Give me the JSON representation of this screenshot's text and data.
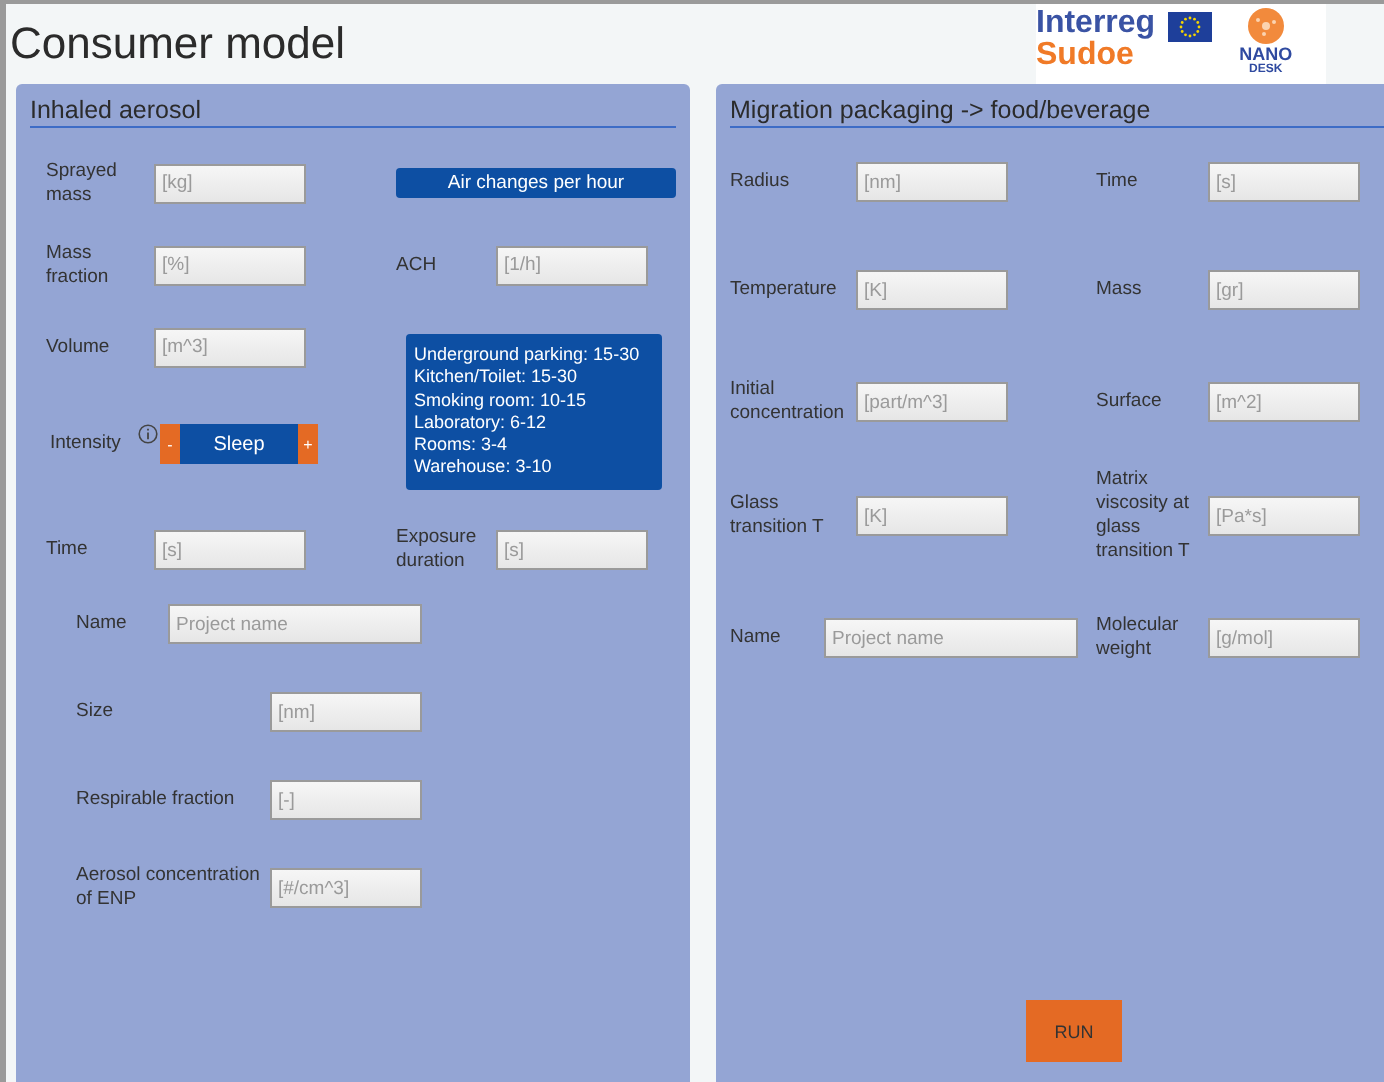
{
  "window": {
    "title": "Consumer model"
  },
  "logos": {
    "interreg": "Interreg",
    "sudoe": "Sudoe",
    "nano": "NANO",
    "desk": "DESK"
  },
  "inhaled_aerosol": {
    "title": "Inhaled aerosol",
    "left_column": [
      {
        "kind": "field",
        "label": "Sprayed mass",
        "placeholder": "[kg]"
      },
      {
        "kind": "field",
        "label": "Mass fraction",
        "placeholder": "[%]"
      },
      {
        "kind": "field",
        "label": "Volume",
        "placeholder": "[m^3]"
      },
      {
        "kind": "stepper",
        "label": "Intensity",
        "minus": "-",
        "value": "Sleep",
        "plus": "+"
      },
      {
        "kind": "field",
        "label": "Time",
        "placeholder": "[s]"
      }
    ],
    "right_column": [
      {
        "kind": "button",
        "label": "Air changes per hour"
      },
      {
        "kind": "field",
        "label": "ACH",
        "placeholder": "[1/h]"
      },
      {
        "kind": "guide",
        "lines": [
          "Underground parking: 15-30",
          "Kitchen/Toilet: 15-30",
          "Smoking room: 10-15",
          "Laboratory: 6-12",
          "Rooms: 3-4",
          "Warehouse: 3-10"
        ]
      },
      {
        "kind": "field",
        "label": "Exposure duration",
        "placeholder": "[s]"
      }
    ],
    "lower_fields": [
      {
        "kind": "text",
        "label": "Name",
        "placeholder": "Project name"
      },
      {
        "kind": "number",
        "label": "Size",
        "placeholder": "[nm]"
      },
      {
        "kind": "number",
        "label": "Respirable fraction",
        "placeholder": "[-]"
      },
      {
        "kind": "number",
        "label": "Aerosol concentration of ENP",
        "placeholder": "[#/cm^3]"
      }
    ]
  },
  "migration": {
    "title": "Migration packaging -> food/beverage",
    "rows": [
      {
        "left": {
          "kind": "number",
          "label": "Radius",
          "placeholder": "[nm]"
        },
        "right": {
          "label": "Time",
          "placeholder": "[s]"
        }
      },
      {
        "left": {
          "kind": "number",
          "label": "Temperature",
          "placeholder": "[K]"
        },
        "right": {
          "label": "Mass",
          "placeholder": "[gr]"
        }
      },
      {
        "left": {
          "kind": "number",
          "label": "Initial concentration",
          "placeholder": "[part/m^3]"
        },
        "right": {
          "label": "Surface",
          "placeholder": "[m^2]"
        }
      },
      {
        "left": {
          "kind": "number",
          "label": "Glass transition T",
          "placeholder": "[K]"
        },
        "right": {
          "label": "Matrix viscosity at glass transition T",
          "placeholder": "[Pa*s]"
        }
      },
      {
        "left": {
          "kind": "text",
          "label": "Name",
          "placeholder": "Project name"
        },
        "right": {
          "label": "Molecular weight",
          "placeholder": "[g/mol]"
        }
      }
    ],
    "run_button": "RUN"
  }
}
